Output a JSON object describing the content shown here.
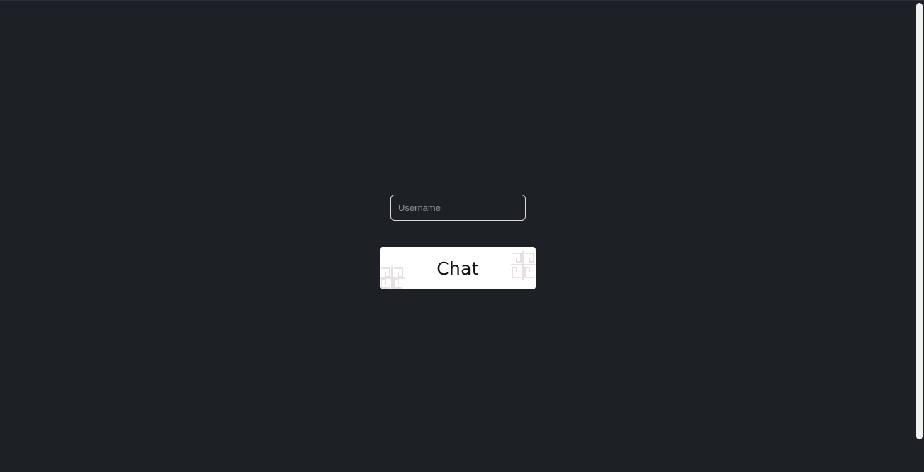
{
  "login": {
    "username_placeholder": "Username",
    "username_value": "",
    "chat_button_label": "Chat"
  },
  "colors": {
    "background": "#1d2025",
    "button_background": "#ffffff",
    "pattern": "#e2d8d8",
    "input_border": "#d9d9d9"
  },
  "icons": {
    "button_decoration": "greek-key-pattern-icon"
  }
}
